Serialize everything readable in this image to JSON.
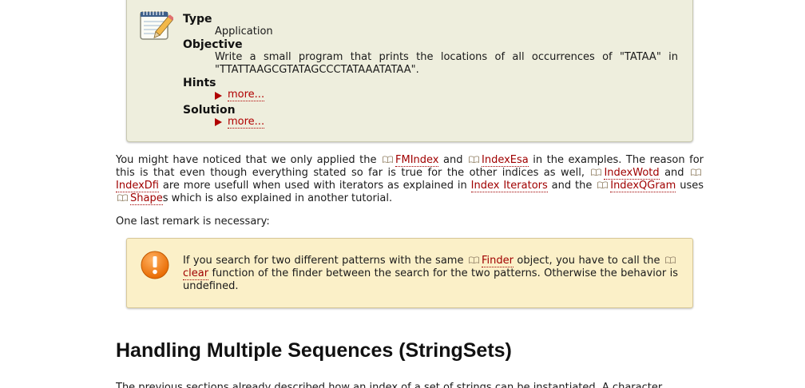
{
  "assignment": {
    "type_label": "Type",
    "type_value": "Application",
    "objective_label": "Objective",
    "objective_text": "Write a small program that prints the locations of all occurrences of \"TATAA\" in \"TTATTAAGCGTATAGCCCTATAAATATAA\".",
    "hints_label": "Hints",
    "hints_more": "more...",
    "solution_label": "Solution",
    "solution_more": "more..."
  },
  "paragraph1": {
    "t1": "You might have noticed that we only applied the ",
    "l1": "FMIndex",
    "t2": " and ",
    "l2": "IndexEsa",
    "t3": " in the examples. The reason for this is that even though everything stated so far is true for the other indices as well, ",
    "l3": "IndexWotd",
    "t4": " and ",
    "l4": "IndexDfi",
    "t5": " are more usefull when used with iterators as explained in ",
    "l5": "Index Iterators",
    "t6": " and the ",
    "l6": "IndexQGram",
    "t7": " uses ",
    "l7": "Shape",
    "t8": "s which is also explained in another tutorial."
  },
  "paragraph2": {
    "text": "One last remark is necessary:"
  },
  "warning": {
    "t1": "If you search for two different patterns with the same ",
    "l1": "Finder",
    "t2": " object, you have to call the ",
    "l2": "clear",
    "t3": " function of the finder between the search for the two patterns. Otherwise the behavior is undefined."
  },
  "section": {
    "heading": "Handling Multiple Sequences (StringSets)"
  },
  "cut_paragraph": {
    "text": "The previous sections already described how an index of a set of strings can be instantiated. A character"
  },
  "colors": {
    "link": "#a00000",
    "assignment_bg": "#eeeedd",
    "warning_bg": "#fbf0c8",
    "warning_icon": "#f07810"
  },
  "icons": {
    "assignment": "notepad-pencil-icon",
    "warning": "exclamation-icon",
    "link": "book-icon"
  }
}
